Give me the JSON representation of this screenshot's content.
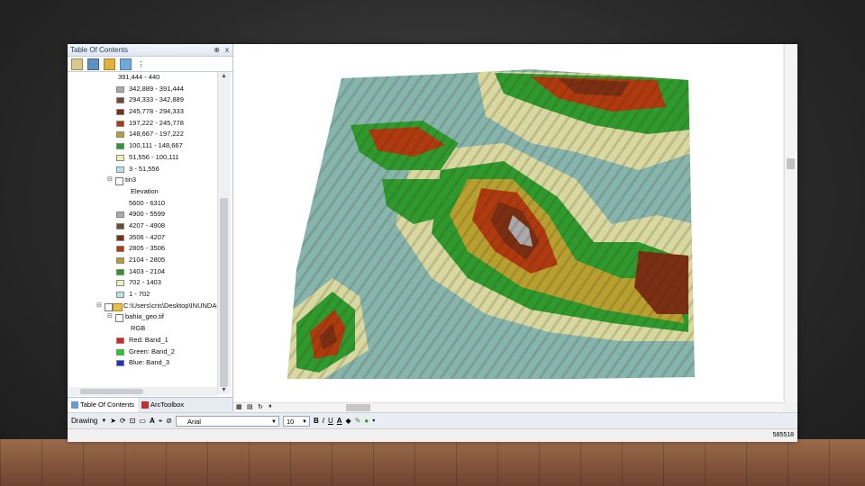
{
  "toc": {
    "title": "Table Of Contents",
    "pin_icon": "pin-icon",
    "close_label": "x",
    "rows": [
      {
        "text": "391,444 - 440",
        "swatch": null,
        "indent": 56
      },
      {
        "text": "342,889 - 391,444",
        "swatch": "#aaaaaa",
        "indent": 68
      },
      {
        "text": "294,333 - 342,889",
        "swatch": "#6e4a32",
        "indent": 68
      },
      {
        "text": "245,778 - 294,333",
        "swatch": "#7a2e12",
        "indent": 68
      },
      {
        "text": "197,222 - 245,778",
        "swatch": "#b03a10",
        "indent": 68
      },
      {
        "text": "148,667 - 197,222",
        "swatch": "#b8a030",
        "indent": 68
      },
      {
        "text": "100,111 - 148,667",
        "swatch": "#2e9a2e",
        "indent": 68
      },
      {
        "text": "51,556 - 100,111",
        "swatch": "#eaf2b8",
        "indent": 68
      },
      {
        "text": "3 - 51,556",
        "swatch": "#b8e4e8",
        "indent": 68
      },
      {
        "text": "tin3",
        "swatch": null,
        "indent": 56,
        "expander": true
      },
      {
        "text": "Elevation",
        "swatch": null,
        "indent": 70
      },
      {
        "text": "5600 - 6310",
        "swatch": null,
        "indent": 68
      },
      {
        "text": "4900 - 5599",
        "swatch": "#aaaaaa",
        "indent": 68
      },
      {
        "text": "4207 - 4908",
        "swatch": "#6e4a32",
        "indent": 68
      },
      {
        "text": "3506 - 4207",
        "swatch": "#7a2e12",
        "indent": 68
      },
      {
        "text": "2805 - 3506",
        "swatch": "#b03a10",
        "indent": 68
      },
      {
        "text": "2104 - 2805",
        "swatch": "#b8a030",
        "indent": 68
      },
      {
        "text": "1403 - 2104",
        "swatch": "#2e9a2e",
        "indent": 68
      },
      {
        "text": "702 - 1403",
        "swatch": "#eaf2b8",
        "indent": 68
      },
      {
        "text": "1 - 702",
        "swatch": "#b8e4e8",
        "indent": 68
      },
      {
        "text": "C:\\Users\\cris\\Desktop\\INUNDAC",
        "swatch": null,
        "indent": 44,
        "expander": true,
        "folder": true
      },
      {
        "text": "bahia_geo.tif",
        "swatch": null,
        "indent": 56,
        "expander": true
      },
      {
        "text": "RGB",
        "swatch": null,
        "indent": 70
      },
      {
        "text": "Red: Band_1",
        "swatch": "#e02020",
        "indent": 68
      },
      {
        "text": "Green: Band_2",
        "swatch": "#20d020",
        "indent": 68
      },
      {
        "text": "Blue: Band_3",
        "swatch": "#2030c0",
        "indent": 68
      }
    ],
    "tab_toc": "Table Of Contents",
    "tab_toolbox": "ArcToolbox"
  },
  "drawbar": {
    "drawing_label": "Drawing",
    "font_name": "Arial",
    "font_size": "10",
    "bold": "B",
    "italic": "I",
    "underline": "U",
    "font_color": "A"
  },
  "status": {
    "coordinates": "585518"
  },
  "colors": {
    "water": "#86b5ad",
    "low": "#d8d8a0",
    "mid_green": "#2e9a2e",
    "brown": "#8b3a14"
  }
}
